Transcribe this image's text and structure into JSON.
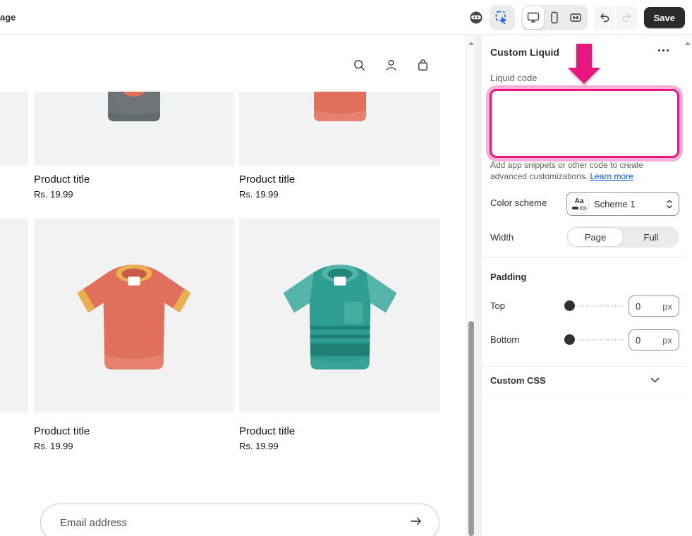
{
  "topbar": {
    "breadcrumb": "age",
    "save_label": "Save"
  },
  "preview": {
    "header_icons": [
      "search",
      "account",
      "cart"
    ],
    "products": [
      {
        "title": "Product title",
        "price": "Rs. 19.99",
        "image": "gray-tshirt-partial"
      },
      {
        "title": "Product title",
        "price": "Rs. 19.99",
        "image": "red-tshirt-partial"
      },
      {
        "title": "Product title",
        "price": "Rs. 19.99",
        "image": "red-tshirt"
      },
      {
        "title": "Product title",
        "price": "Rs. 19.99",
        "image": "teal-tshirt"
      }
    ],
    "newsletter": {
      "placeholder": "Email address"
    }
  },
  "panel": {
    "title": "Custom Liquid",
    "liquid_code": {
      "label": "Liquid code",
      "value": ""
    },
    "helper": {
      "text": "Add app snippets or other code to create advanced customizations. ",
      "link": "Learn more"
    },
    "color_scheme": {
      "label": "Color scheme",
      "value": "Scheme 1",
      "chip": "Aa"
    },
    "width": {
      "label": "Width",
      "options": [
        "Page",
        "Full"
      ],
      "selected": "Page"
    },
    "padding": {
      "title": "Padding",
      "rows": [
        {
          "label": "Top",
          "value": "0",
          "unit": "px"
        },
        {
          "label": "Bottom",
          "value": "0",
          "unit": "px"
        }
      ]
    },
    "custom_css": {
      "label": "Custom CSS"
    }
  },
  "colors": {
    "highlight_pink": "#e81780",
    "highlight_halo": "#f6b1d6",
    "link_blue": "#005bd3",
    "save_dark": "#2b2b2b",
    "tool_blue": "#1f6be6",
    "card_gray": "#f2f2f2",
    "shirt_red": "#e0705c",
    "shirt_teal": "#2f9e92",
    "shirt_gray": "#6e7475",
    "trim_yellow": "#e8b04e"
  }
}
